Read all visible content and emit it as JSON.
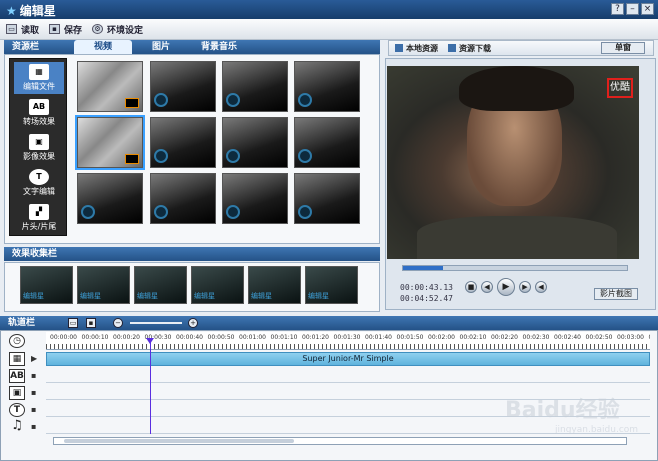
{
  "app": {
    "title": "编辑星"
  },
  "toolbar": {
    "read": "读取",
    "save": "保存",
    "settings": "环境设定"
  },
  "resource": {
    "header": "资源栏",
    "tabs": [
      "视频",
      "图片",
      "背景音乐"
    ],
    "categories": [
      "编辑文件",
      "转场效果",
      "影像效果",
      "文字编辑",
      "片头/片尾"
    ]
  },
  "preview": {
    "local": "本地资源",
    "download": "资源下载",
    "button": "单窗",
    "logo": "优酷",
    "time_current": "00:00:43.13",
    "time_total": "00:04:52.47",
    "snapshot": "影片截图"
  },
  "effects": {
    "header": "效果收集栏",
    "label": "编辑星"
  },
  "track": {
    "header": "轨道栏",
    "clip": "Super Junior-Mr Simple",
    "ticks": [
      "00:00:00",
      "00:00:10",
      "00:00:20",
      "00:00:30",
      "00:00:40",
      "00:00:50",
      "00:01:00",
      "00:01:10",
      "00:01:20",
      "00:01:30",
      "00:01:40",
      "00:01:50",
      "00:02:00",
      "00:02:10",
      "00:02:20",
      "00:02:30",
      "00:02:40",
      "00:02:50",
      "00:03:00",
      "00:03:10"
    ]
  },
  "watermark": {
    "main": "Baidu经验",
    "sub": "jingyan.baidu.com"
  }
}
